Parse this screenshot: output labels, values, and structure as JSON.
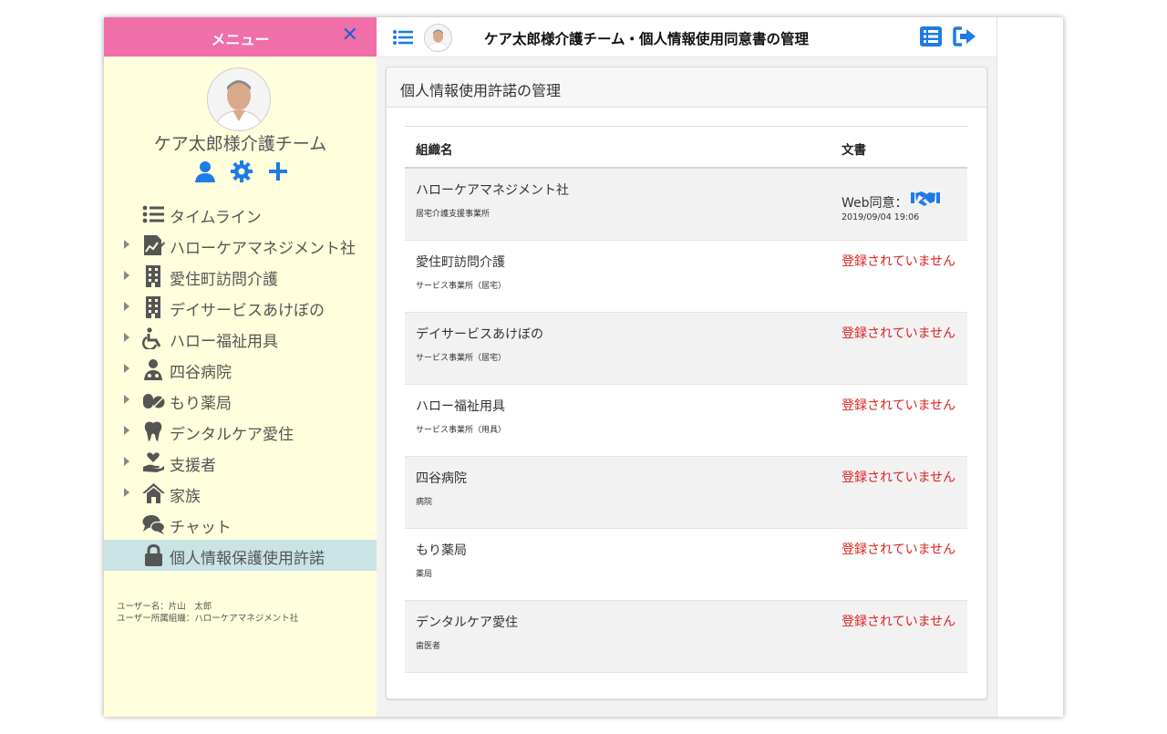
{
  "sidebar": {
    "title": "メニュー",
    "close_icon": "close-icon",
    "team_name": "ケア太郎様介護チーム",
    "actions": [
      "user-icon",
      "gear-icon",
      "plus-icon"
    ],
    "items": [
      {
        "label": "タイムライン",
        "icon": "list-icon",
        "expandable": false
      },
      {
        "label": "ハローケアマネジメント社",
        "icon": "chart-document-icon",
        "expandable": true
      },
      {
        "label": "愛住町訪問介護",
        "icon": "building-icon",
        "expandable": true
      },
      {
        "label": "デイサービスあけぼの",
        "icon": "building-icon",
        "expandable": true
      },
      {
        "label": "ハロー福祉用具",
        "icon": "wheelchair-icon",
        "expandable": true
      },
      {
        "label": "四谷病院",
        "icon": "doctor-icon",
        "expandable": true
      },
      {
        "label": "もり薬局",
        "icon": "pills-icon",
        "expandable": true
      },
      {
        "label": "デンタルケア愛住",
        "icon": "tooth-icon",
        "expandable": true
      },
      {
        "label": "支援者",
        "icon": "hand-heart-icon",
        "expandable": true
      },
      {
        "label": "家族",
        "icon": "house-icon",
        "expandable": true
      },
      {
        "label": "チャット",
        "icon": "chat-icon",
        "expandable": false
      },
      {
        "label": "個人情報保護使用許諾",
        "icon": "lock-icon",
        "expandable": false,
        "active": true
      }
    ],
    "user_name": "ユーザー名：片山　太郎",
    "user_org": "ユーザー所属組織：ハローケアマネジメント社"
  },
  "topbar": {
    "title": "ケア太郎様介護チーム・個人情報使用同意書の管理"
  },
  "card": {
    "title": "個人情報使用許諾の管理",
    "columns": [
      "組織名",
      "文書"
    ],
    "rows": [
      {
        "name": "ハローケアマネジメント社",
        "type": "居宅介護支援事業所",
        "status": "",
        "web_label": "Web同意：",
        "date": "2019/09/04 19:06"
      },
      {
        "name": "愛住町訪問介護",
        "type": "サービス事業所（居宅）",
        "status": "登録されていません"
      },
      {
        "name": "デイサービスあけぼの",
        "type": "サービス事業所（居宅）",
        "status": "登録されていません"
      },
      {
        "name": "ハロー福祉用具",
        "type": "サービス事業所（用具）",
        "status": "登録されていません"
      },
      {
        "name": "四谷病院",
        "type": "病院",
        "status": "登録されていません"
      },
      {
        "name": "もり薬局",
        "type": "薬局",
        "status": "登録されていません"
      },
      {
        "name": "デンタルケア愛住",
        "type": "歯医者",
        "status": "登録されていません"
      }
    ]
  },
  "colors": {
    "sidebar_header": "#f06fa8",
    "sidebar_bg": "#ffffdd",
    "accent_blue": "#1e7be6",
    "status_red": "#e02020",
    "active_item": "#cae4e6"
  }
}
